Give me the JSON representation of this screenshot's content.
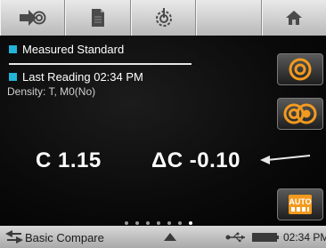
{
  "topbar": {
    "tabs": [
      {
        "icon": "measure-icon"
      },
      {
        "icon": "document-icon"
      },
      {
        "icon": "tools-icon"
      },
      {
        "icon": "blank-tab"
      },
      {
        "icon": "home-icon"
      }
    ]
  },
  "main": {
    "standard_label": "Measured Standard",
    "reading_label": "Last Reading 02:34 PM",
    "density_info": "Density: T, M0(No)",
    "value_c": "C 1.15",
    "value_delta": "ΔC -0.10",
    "page_dots": 7,
    "active_dot": 7
  },
  "sidebar": {
    "buttons": [
      {
        "icon": "target-icon"
      },
      {
        "icon": "compare-targets-icon"
      },
      {
        "icon": "auto-icon",
        "label": "AUTO"
      }
    ]
  },
  "statusbar": {
    "mode_label": "Basic Compare",
    "time": "02:34 PM"
  },
  "colors": {
    "accent_square": "#22b3d9",
    "orange_icon": "#f39a1e"
  }
}
